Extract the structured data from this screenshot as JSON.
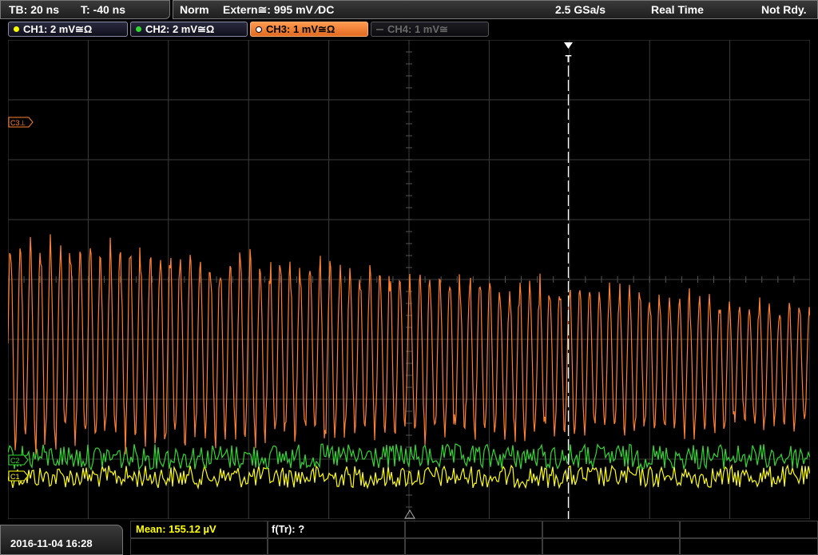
{
  "header": {
    "timebase": "TB: 20 ns",
    "trigger_time": "T: -40 ns",
    "trigger_mode": "Norm",
    "trigger_source": "Extern≅: 995 mV ⁄DC",
    "sample_rate": "2.5 GSa/s",
    "acq_mode": "Real Time",
    "status": "Not Rdy."
  },
  "channels": [
    {
      "label": "CH1: 2 mV≅Ω",
      "color": "#ffff00",
      "active": true
    },
    {
      "label": "CH2: 2 mV≅Ω",
      "color": "#30d830",
      "active": true
    },
    {
      "label": "CH3: 1 mV≅Ω",
      "color": "#ff8030",
      "active": true,
      "selected": true
    },
    {
      "label": "CH4: 1 mV≅",
      "color": "#777777",
      "active": false
    }
  ],
  "screen": {
    "ch3_marker": "C3⊥",
    "ch1_marker": "C1",
    "ch2_marker": "C2",
    "trigger_marker": "T",
    "colors": {
      "grid": "#3c3c3c",
      "ch1": "#ffff00",
      "ch2": "#30d830",
      "ch3": "#ff7f30"
    }
  },
  "footer": {
    "datetime": "2016-11-04 16:28",
    "mean_label": "Mean: 155.12 µV",
    "freq_label": "f(Tr): ?"
  }
}
